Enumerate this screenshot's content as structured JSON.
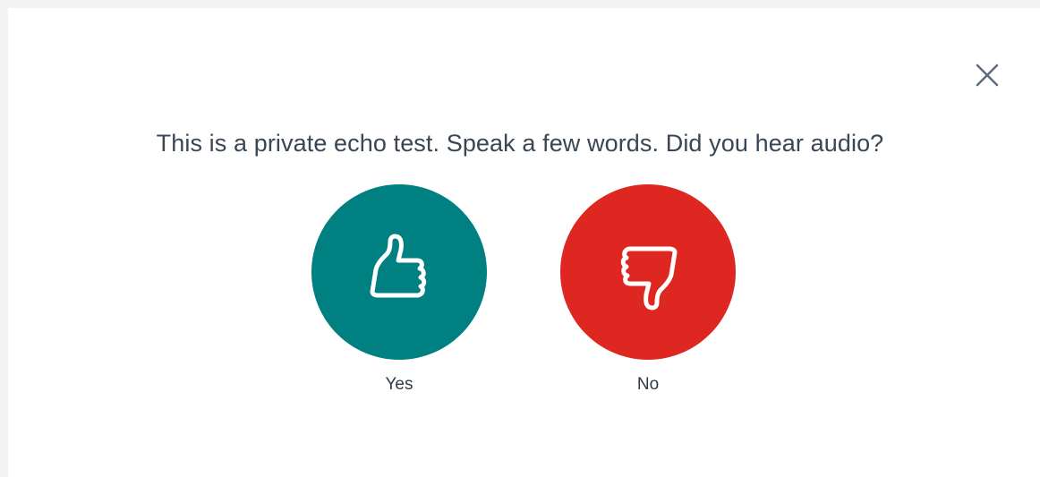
{
  "dialog": {
    "prompt": "This is a private echo test. Speak a few words. Did you hear audio?",
    "close_icon": "close-icon",
    "answers": [
      {
        "label": "Yes",
        "icon": "thumbs-up-icon",
        "color": "#008080"
      },
      {
        "label": "No",
        "icon": "thumbs-down-icon",
        "color": "#df2721"
      }
    ]
  },
  "colors": {
    "text": "#3a4654",
    "close_icon": "#5f6b7a",
    "yes": "#008080",
    "no": "#df2721",
    "backdrop": "#f3f4f5"
  }
}
